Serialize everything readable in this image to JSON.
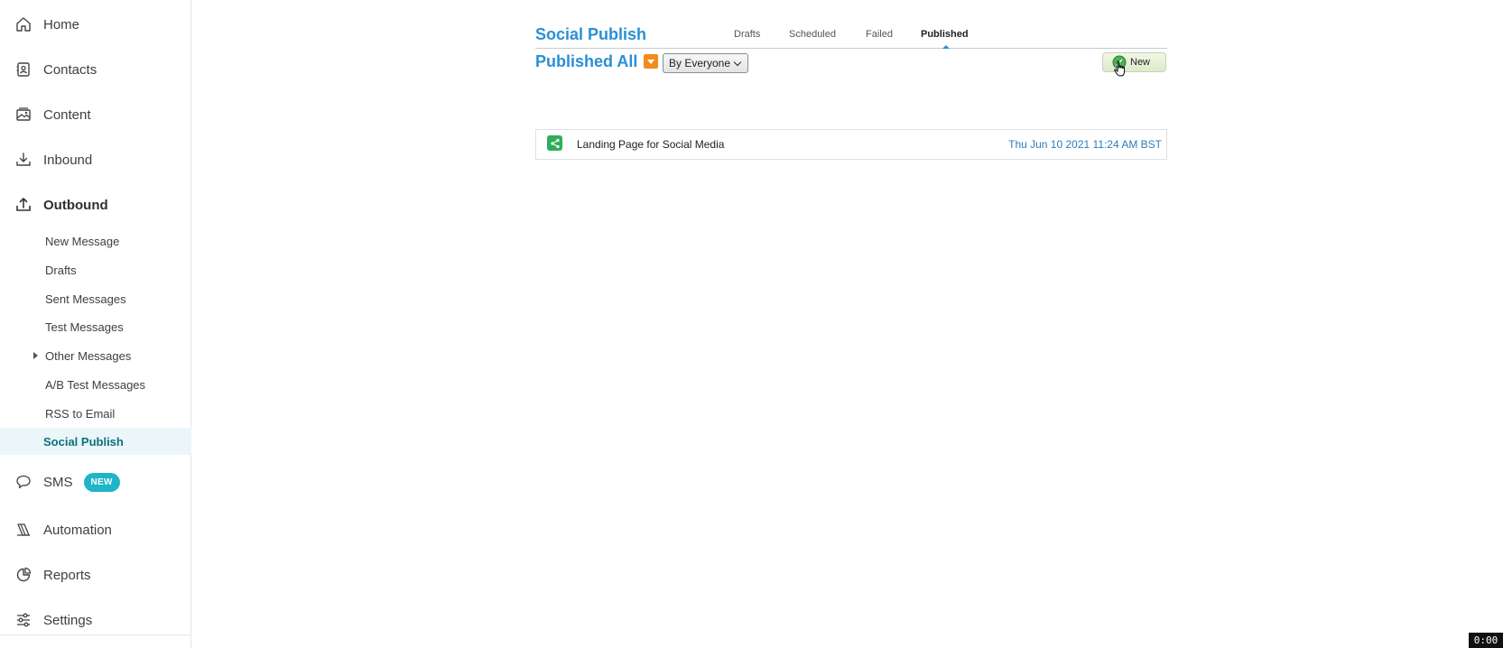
{
  "sidebar": {
    "nav": [
      {
        "label": "Home",
        "icon": "home-icon"
      },
      {
        "label": "Contacts",
        "icon": "contacts-icon"
      },
      {
        "label": "Content",
        "icon": "content-icon"
      },
      {
        "label": "Inbound",
        "icon": "inbound-icon"
      },
      {
        "label": "Outbound",
        "icon": "outbound-icon"
      },
      {
        "label": "SMS",
        "icon": "sms-icon",
        "badge": "NEW"
      },
      {
        "label": "Automation",
        "icon": "automation-icon"
      },
      {
        "label": "Reports",
        "icon": "reports-icon"
      },
      {
        "label": "Settings",
        "icon": "settings-icon"
      }
    ],
    "outbound_items": [
      {
        "label": "New Message"
      },
      {
        "label": "Drafts"
      },
      {
        "label": "Sent Messages"
      },
      {
        "label": "Test Messages"
      },
      {
        "label": "Other Messages"
      },
      {
        "label": "A/B Test Messages"
      },
      {
        "label": "RSS to Email"
      },
      {
        "label": "Social Publish"
      }
    ]
  },
  "main": {
    "title": "Social Publish",
    "tabs": [
      {
        "label": "Drafts"
      },
      {
        "label": "Scheduled"
      },
      {
        "label": "Failed"
      },
      {
        "label": "Published"
      }
    ],
    "subtitle": "Published All",
    "filter": {
      "selected": "By Everyone"
    },
    "new_button": "New",
    "rows": [
      {
        "name": "Landing Page for Social Media",
        "date": "Thu Jun 10 2021 11:24 AM BST"
      }
    ]
  },
  "timer": "0:00",
  "colors": {
    "accent": "#2a8fd6",
    "active_bg": "#eaf6f8",
    "badge": "#1fb4c9",
    "filter": "#f28c1c",
    "share": "#2eaf5a"
  }
}
